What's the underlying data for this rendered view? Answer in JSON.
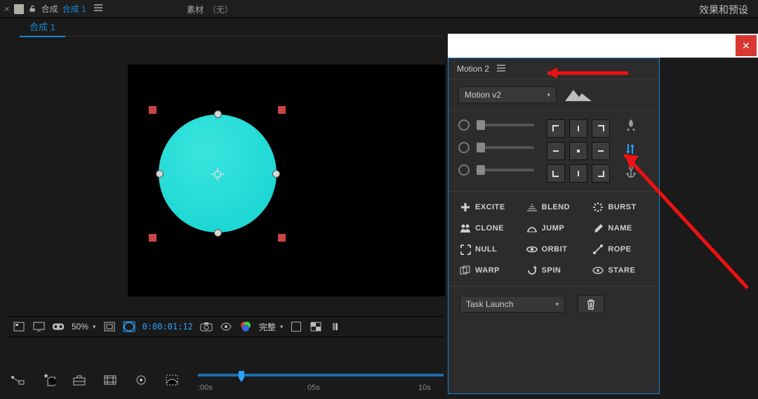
{
  "header": {
    "close_x": "×",
    "comp_label": "合成",
    "comp_active": "合成 1",
    "footage_label": "素材",
    "footage_none": "（无）",
    "subtab": "合成 1",
    "right_tab": "效果和预设"
  },
  "footer": {
    "zoom": "50%",
    "timecode": "0:00:01:12",
    "render_label": "完整"
  },
  "timeline": {
    "t0": ":00s",
    "t1": "05s",
    "t2": "10s"
  },
  "panel": {
    "title": "Motion 2",
    "version": "Motion v2",
    "tools": [
      {
        "icon": "plus",
        "label": "EXCITE"
      },
      {
        "icon": "blend",
        "label": "BLEND"
      },
      {
        "icon": "burst",
        "label": "BURST"
      },
      {
        "icon": "clone",
        "label": "CLONE"
      },
      {
        "icon": "jump",
        "label": "JUMP"
      },
      {
        "icon": "name",
        "label": "NAME"
      },
      {
        "icon": "null",
        "label": "NULL"
      },
      {
        "icon": "orbit",
        "label": "ORBIT"
      },
      {
        "icon": "rope",
        "label": "ROPE"
      },
      {
        "icon": "warp",
        "label": "WARP"
      },
      {
        "icon": "spin",
        "label": "SPIN"
      },
      {
        "icon": "stare",
        "label": "STARE"
      }
    ],
    "task_launch": "Task Launch"
  }
}
